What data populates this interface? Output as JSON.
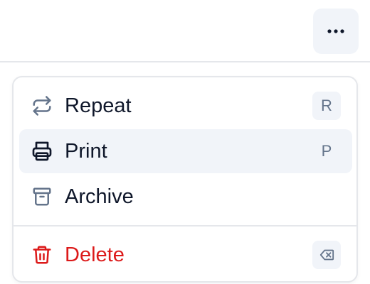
{
  "header": {
    "more_icon": "more-horizontal-icon"
  },
  "menu": {
    "items": [
      {
        "label": "Repeat",
        "icon": "repeat-icon",
        "shortcut": "R"
      },
      {
        "label": "Print",
        "icon": "printer-icon",
        "shortcut": "P",
        "highlighted": true
      },
      {
        "label": "Archive",
        "icon": "archive-icon",
        "shortcut": ""
      }
    ],
    "danger_item": {
      "label": "Delete",
      "icon": "trash-icon",
      "shortcut_icon": "backspace-icon"
    }
  },
  "colors": {
    "text": "#0f172a",
    "muted_icon": "#64748b",
    "danger": "#dc1a1a",
    "highlight_bg": "#f1f4f9",
    "border": "#e5e7eb"
  }
}
